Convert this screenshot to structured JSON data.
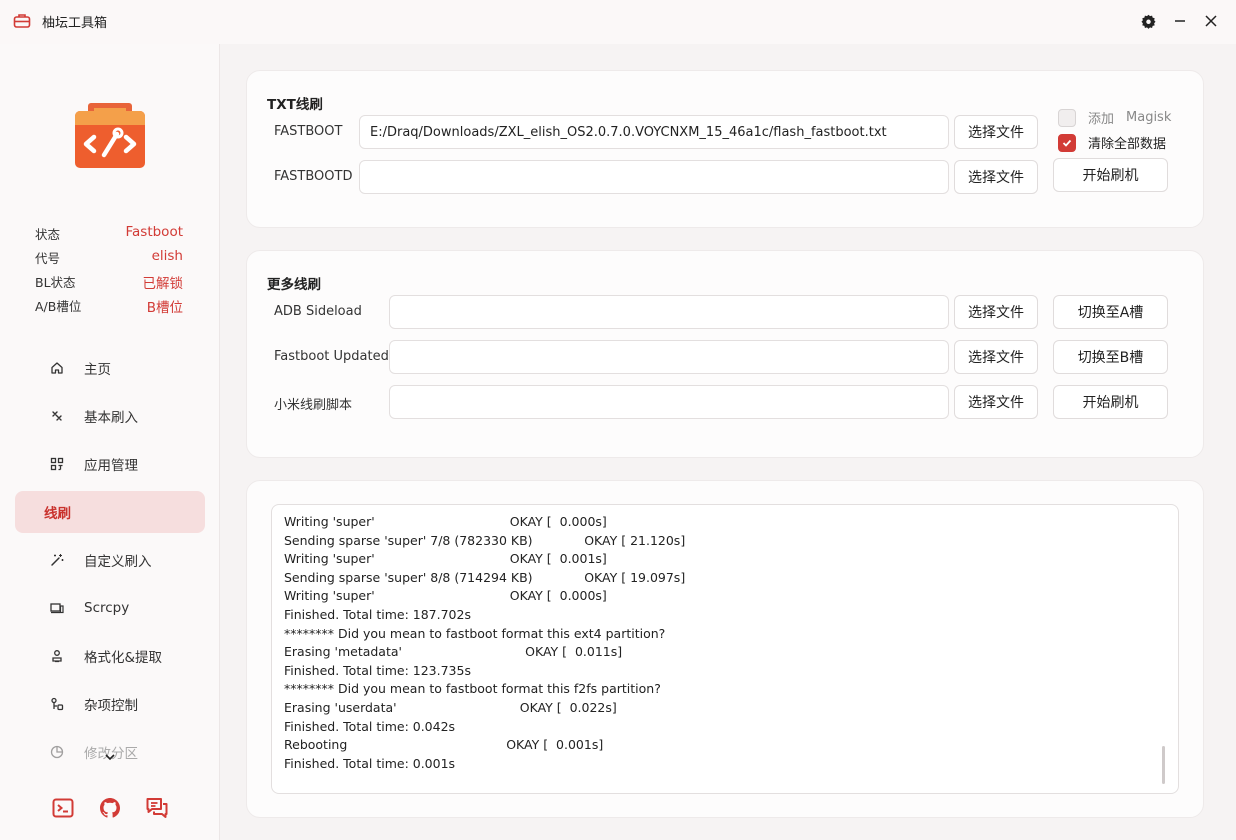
{
  "app": {
    "title": "柚坛工具箱"
  },
  "colors": {
    "accent": "#d23b36",
    "active_bg": "#f6dede"
  },
  "status": [
    {
      "key": "状态",
      "value": "Fastboot"
    },
    {
      "key": "代号",
      "value": "elish"
    },
    {
      "key": "BL状态",
      "value": "已解锁"
    },
    {
      "key": "A/B槽位",
      "value": "B槽位"
    }
  ],
  "nav": [
    {
      "label": "主页",
      "icon": "home-icon"
    },
    {
      "label": "基本刷入",
      "icon": "flash-icon"
    },
    {
      "label": "应用管理",
      "icon": "apps-icon"
    },
    {
      "label": "线刷",
      "icon": "",
      "active": true
    },
    {
      "label": "自定义刷入",
      "icon": "wand-icon"
    },
    {
      "label": "Scrcpy",
      "icon": "screen-mirror-icon"
    },
    {
      "label": "格式化&提取",
      "icon": "format-icon"
    },
    {
      "label": "杂项控制",
      "icon": "misc-icon"
    },
    {
      "label": "修改分区",
      "icon": "partition-icon"
    }
  ],
  "txt_flash": {
    "title": "TXT线刷",
    "fastboot_label": "FASTBOOT",
    "fastboot_value": "E:/Draq/Downloads/ZXL_elish_OS2.0.7.0.VOYCNXM_15_46a1c/flash_fastboot.txt",
    "fastbootd_label": "FASTBOOTD",
    "fastbootd_value": "",
    "select_file": "选择文件",
    "add_magisk": "添加",
    "magisk": "Magisk",
    "clear_all": "清除全部数据",
    "start": "开始刷机"
  },
  "more_flash": {
    "title": "更多线刷",
    "adb_label": "ADB Sideload",
    "fb_updated_label": "Fastboot Updated",
    "mi_script_label": "小米线刷脚本",
    "select_file": "选择文件",
    "switch_a": "切换至A槽",
    "switch_b": "切换至B槽",
    "start": "开始刷机"
  },
  "log": [
    "Writing 'super'                                  OKAY [  0.000s]",
    "Sending sparse 'super' 7/8 (782330 KB)             OKAY [ 21.120s]",
    "Writing 'super'                                  OKAY [  0.001s]",
    "Sending sparse 'super' 8/8 (714294 KB)             OKAY [ 19.097s]",
    "Writing 'super'                                  OKAY [  0.000s]",
    "Finished. Total time: 187.702s",
    "******** Did you mean to fastboot format this ext4 partition?",
    "Erasing 'metadata'                               OKAY [  0.011s]",
    "Finished. Total time: 123.735s",
    "******** Did you mean to fastboot format this f2fs partition?",
    "Erasing 'userdata'                               OKAY [  0.022s]",
    "Finished. Total time: 0.042s",
    "Rebooting                                        OKAY [  0.001s]",
    "Finished. Total time: 0.001s"
  ]
}
